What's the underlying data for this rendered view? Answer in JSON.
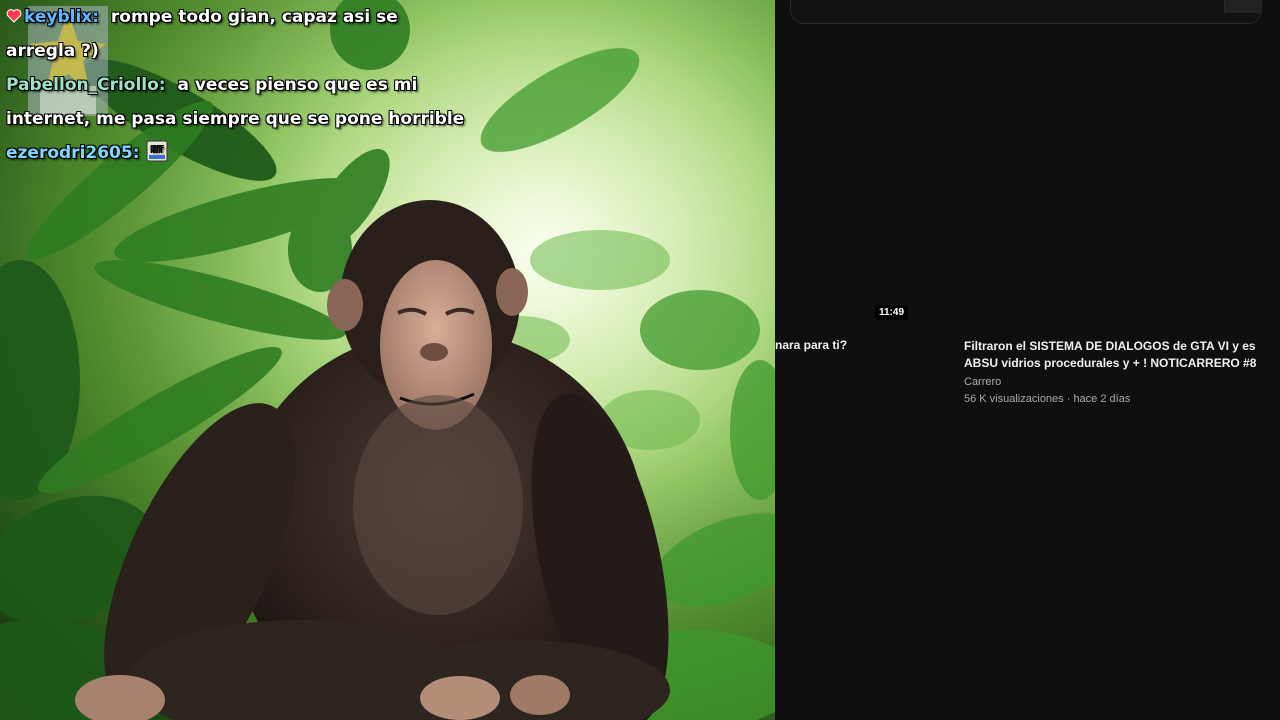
{
  "chat": {
    "messages": [
      {
        "user": "keyblix:",
        "text": "rompe todo gian, capaz asi se arregla ?)"
      },
      {
        "user": "Pabellon_Criollo:",
        "text": "a veces pienso que es mi internet, me pasa siempre que se pone horrible"
      },
      {
        "user": "ezerodri2605:",
        "text": "",
        "emote": "NT",
        "emote_label": "NT"
      }
    ]
  },
  "youtube": {
    "duration": "11:49",
    "prev_title_fragment": "nara para ti?",
    "video": {
      "title": "Filtraron el SISTEMA DE DIALOGOS de GTA VI y es ABSU vidrios procedurales y + ! NOTICARRERO #8",
      "channel": "Carrero",
      "meta": "56 K visualizaciones · hace 2 días"
    }
  },
  "colors": {
    "panel_bg": "#0f0f0f",
    "text_primary": "#f1f1f1",
    "text_secondary": "#aaaaaa",
    "chat_user_1": "#7fd6ff",
    "chat_user_2": "#9fe0c8",
    "chat_user_3": "#62b8ff"
  },
  "icons": {
    "heart": "heart-icon",
    "emote": "nt-emote-icon",
    "badge": "subscriber-badge-icon"
  }
}
